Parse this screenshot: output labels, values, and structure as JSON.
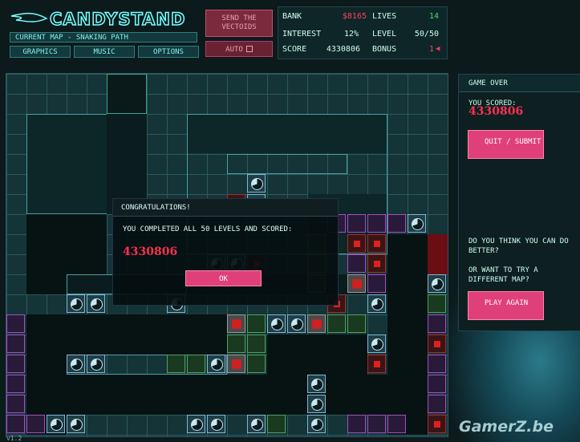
{
  "header": {
    "logo": "CANDYSTAND",
    "current_map": "CURRENT MAP - SNAKING PATH",
    "buttons": {
      "graphics": "GRAPHICS",
      "music": "MUSIC",
      "options": "OPTIONS"
    },
    "send_vectoids": "SEND THE VECTOIDS",
    "auto": "AUTO"
  },
  "stats": {
    "bank_label": "BANK",
    "bank_value": "$8165",
    "lives_label": "LIVES",
    "lives_value": "14",
    "interest_label": "INTEREST",
    "interest_value": "12%",
    "level_label": "LEVEL",
    "level_value": "50/50",
    "score_label": "SCORE",
    "score_value": "4330806",
    "bonus_label": "BONUS",
    "bonus_value": "1"
  },
  "dialog": {
    "title": "CONGRATULATIONS!",
    "message": "YOU COMPLETED ALL 50 LEVELS AND SCORED:",
    "score": "4330806",
    "ok": "OK"
  },
  "panel": {
    "title": "GAME OVER",
    "you_scored": "YOU SCORED:",
    "score": "4330806",
    "quit_submit": "QUIT / SUBMIT",
    "can_do_better": "DO YOU THINK YOU CAN DO BETTER?",
    "try_map": "OR WANT TO TRY A DIFFERENT MAP?",
    "play_again": "PLAY AGAIN"
  },
  "version": "v1.2",
  "watermark": "GamerZ.be",
  "colors": {
    "accent": "#e0407a",
    "score": "#ff3050",
    "bank": "#ff4060",
    "lives": "#40e060",
    "path": "#071213"
  }
}
